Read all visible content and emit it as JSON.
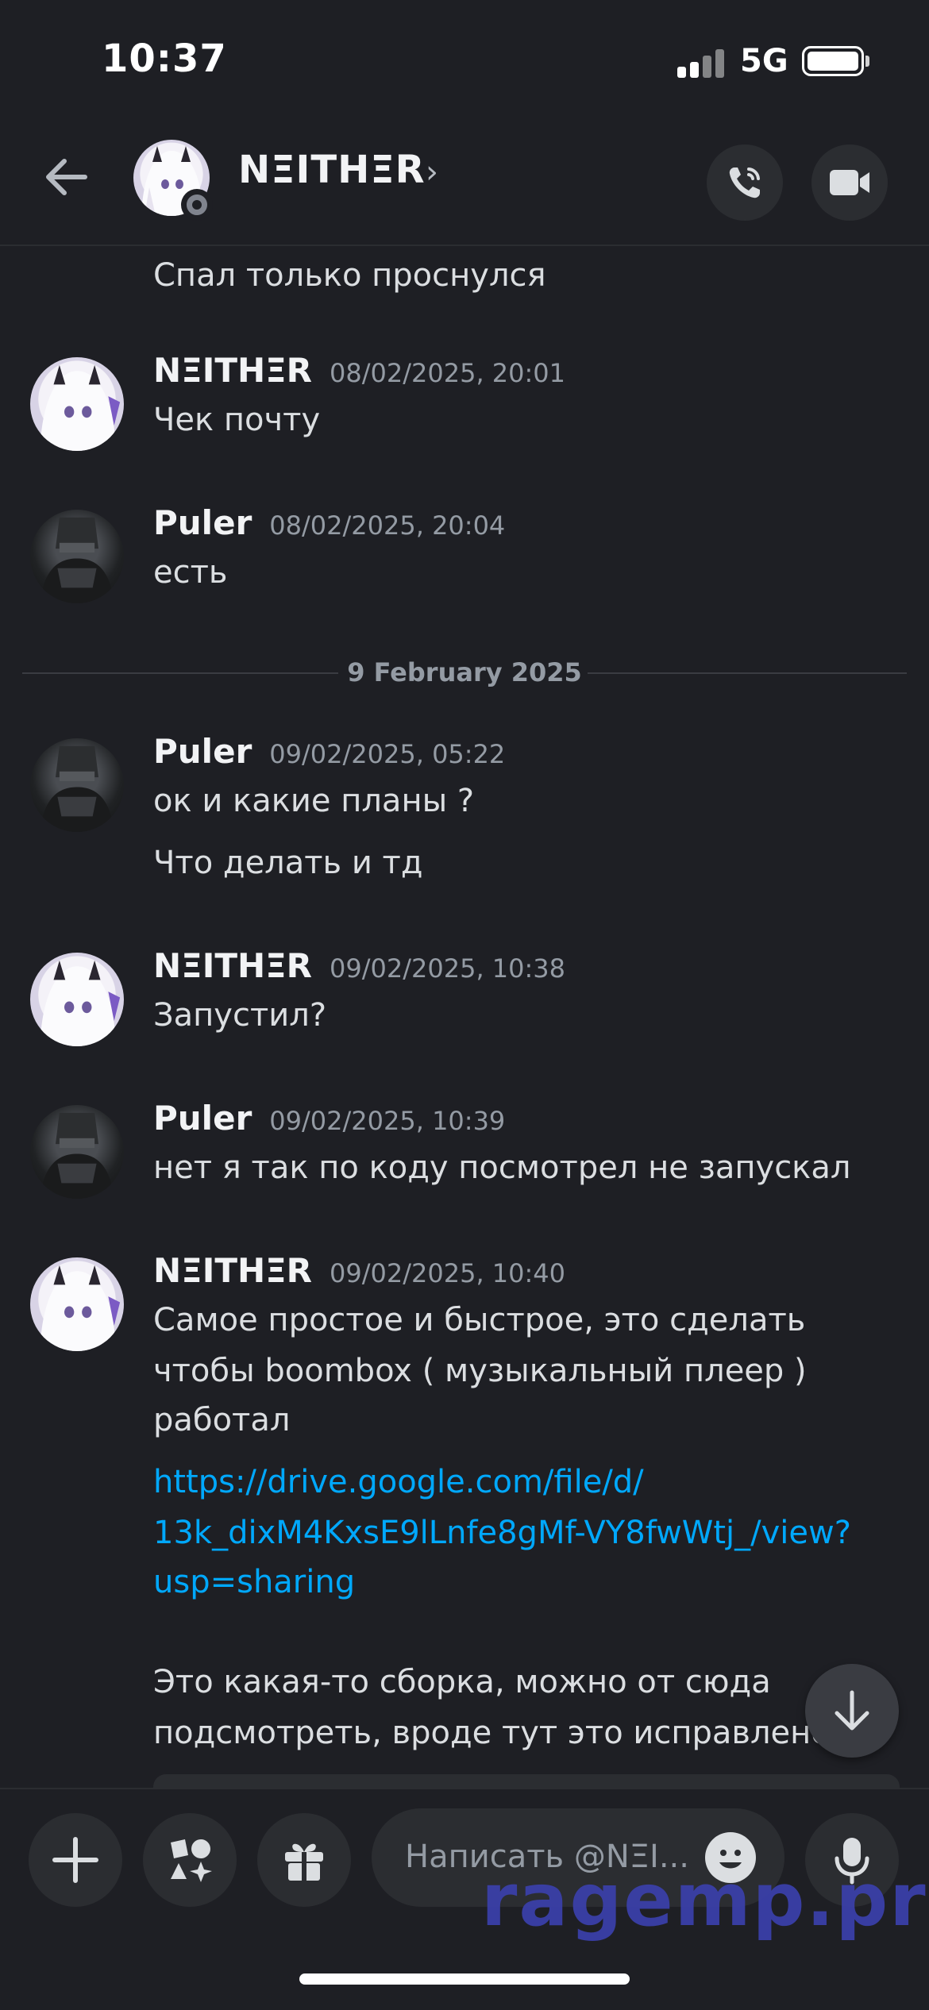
{
  "status_bar": {
    "time": "10:37",
    "network": "5G"
  },
  "header": {
    "contact_name": "NΞITHΞR",
    "chevron": "›"
  },
  "messages": [
    {
      "author": "",
      "timestamp": "",
      "lines": [
        "Спал только проснулся"
      ]
    },
    {
      "author": "NΞITHΞR",
      "timestamp": "08/02/2025, 20:01",
      "lines": [
        "Чек почту"
      ]
    },
    {
      "author": "Puler",
      "timestamp": "08/02/2025, 20:04",
      "lines": [
        "есть"
      ]
    },
    {
      "author": "Puler",
      "timestamp": "09/02/2025, 05:22",
      "lines": [
        "ок и какие планы ?",
        "Что делать и тд"
      ]
    },
    {
      "author": "NΞITHΞR",
      "timestamp": "09/02/2025, 10:38",
      "lines": [
        "Запустил?"
      ]
    },
    {
      "author": "Puler",
      "timestamp": "09/02/2025, 10:39",
      "lines": [
        "нет я так по коду посмотрел не  запускал"
      ]
    },
    {
      "author": "NΞITHΞR",
      "timestamp": "09/02/2025, 10:40",
      "lines": [
        "Самое простое и быстрое, это сделать",
        "чтобы boombox ( музыкальный плеер )",
        "работал"
      ],
      "link_lines": [
        "https://drive.google.com/file/d/",
        "13k_dixM4KxsE9lLnfe8gMf-VY8fwWtj_/view?",
        "usp=sharing"
      ],
      "after_lines": [
        "Это какая-то сборка, можно от сюда",
        "подсмотреть, вроде тут это исправлено"
      ]
    }
  ],
  "date_divider": "9 February 2025",
  "composer": {
    "placeholder": "Написать @NΞI..."
  },
  "watermark": "ragemp.pro",
  "colors": {
    "background": "#1e1f24",
    "surface": "#2b2d31",
    "link": "#00a8fc",
    "muted": "#949ba4"
  }
}
